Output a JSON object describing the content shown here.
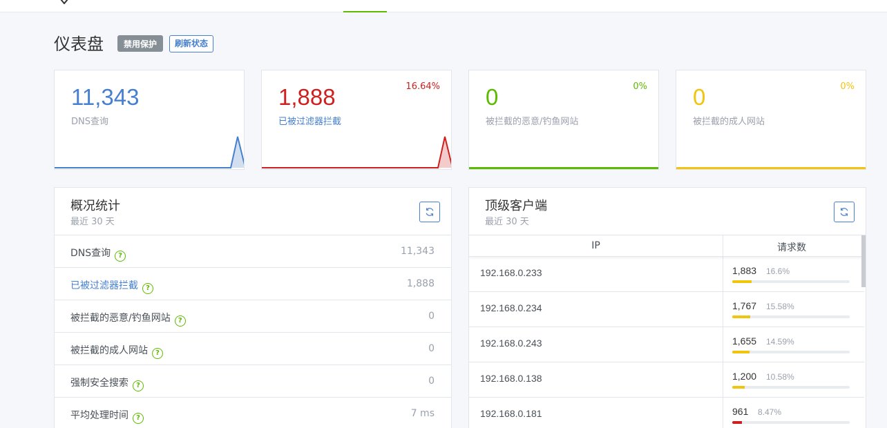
{
  "header": {
    "logo_text": "~"
  },
  "page": {
    "title": "仪表盘",
    "disable_protection_label": "禁用保护",
    "refresh_status_label": "刷新状态"
  },
  "stats": [
    {
      "value": "11,343",
      "label": "DNS查询",
      "percent": "",
      "color": "#467fcf"
    },
    {
      "value": "1,888",
      "label": "已被过滤器拦截",
      "percent": "16.64%",
      "color": "#cd201f"
    },
    {
      "value": "0",
      "label": "被拦截的恶意/钓鱼网站",
      "percent": "0%",
      "color": "#5eba00"
    },
    {
      "value": "0",
      "label": "被拦截的成人网站",
      "percent": "0%",
      "color": "#f1c40f"
    }
  ],
  "overview": {
    "title": "概况统计",
    "subtitle": "最近 30 天",
    "rows": [
      {
        "label": "DNS查询",
        "value": "11,343"
      },
      {
        "label": "已被过滤器拦截",
        "value": "1,888"
      },
      {
        "label": "被拦截的恶意/钓鱼网站",
        "value": "0"
      },
      {
        "label": "被拦截的成人网站",
        "value": "0"
      },
      {
        "label": "强制安全搜索",
        "value": "0"
      },
      {
        "label": "平均处理时间",
        "value": "7 ms"
      }
    ]
  },
  "clients": {
    "title": "顶级客户端",
    "subtitle": "最近 30 天",
    "col_ip": "IP",
    "col_requests": "请求数",
    "rows": [
      {
        "ip": "192.168.0.233",
        "count": "1,883",
        "percent": "16.6%",
        "fill": 0.166,
        "color": "#f1c40f"
      },
      {
        "ip": "192.168.0.234",
        "count": "1,767",
        "percent": "15.58%",
        "fill": 0.1558,
        "color": "#f1c40f"
      },
      {
        "ip": "192.168.0.243",
        "count": "1,655",
        "percent": "14.59%",
        "fill": 0.1459,
        "color": "#f1c40f"
      },
      {
        "ip": "192.168.0.138",
        "count": "1,200",
        "percent": "10.58%",
        "fill": 0.1058,
        "color": "#f1c40f"
      },
      {
        "ip": "192.168.0.181",
        "count": "961",
        "percent": "8.47%",
        "fill": 0.0847,
        "color": "#cd201f"
      }
    ]
  }
}
